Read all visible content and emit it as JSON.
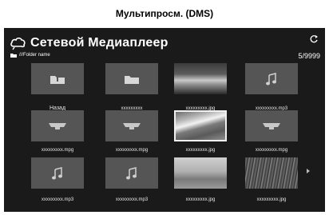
{
  "caption": "Мультипросм. (DMS)",
  "header": {
    "title": "Сетевой Медиаплеер",
    "logo_icon": "cloud-icon",
    "refresh_icon": "refresh-icon"
  },
  "path": {
    "icon": "folder-icon",
    "text": "///Folder name"
  },
  "counter": "5/9999",
  "grid": [
    {
      "kind": "back",
      "icon": "back-folder-icon",
      "label": "Назад"
    },
    {
      "kind": "folder",
      "icon": "folder-icon",
      "label": "xxxxxxxxx"
    },
    {
      "kind": "photo",
      "icon": "photo-icon",
      "label": "xxxxxxxxx.jpg"
    },
    {
      "kind": "music",
      "icon": "music-icon",
      "label": "xxxxxxxxx.mp3"
    },
    {
      "kind": "video",
      "icon": "video-icon",
      "label": "xxxxxxxxx.mpg"
    },
    {
      "kind": "video",
      "icon": "video-icon",
      "label": "xxxxxxxxx.mpg"
    },
    {
      "kind": "photo",
      "icon": "photo-icon",
      "label": "xxxxxxxxx.jpg",
      "selected": true
    },
    {
      "kind": "video",
      "icon": "video-icon",
      "label": "xxxxxxxxx.mpg"
    },
    {
      "kind": "music",
      "icon": "music-icon",
      "label": "xxxxxxxxx.mp3"
    },
    {
      "kind": "music",
      "icon": "music-icon",
      "label": "xxxxxxxxx.mp3"
    },
    {
      "kind": "photo",
      "icon": "photo-icon",
      "label": "xxxxxxxxx.jpg"
    },
    {
      "kind": "photo",
      "icon": "photo-icon",
      "label": "xxxxxxxxx.jpg"
    }
  ],
  "next_icon": "chevron-right-icon",
  "colors": {
    "screen_bg": "#1a1a1a",
    "tile_bg": "#555555",
    "text": "#ffffff"
  }
}
